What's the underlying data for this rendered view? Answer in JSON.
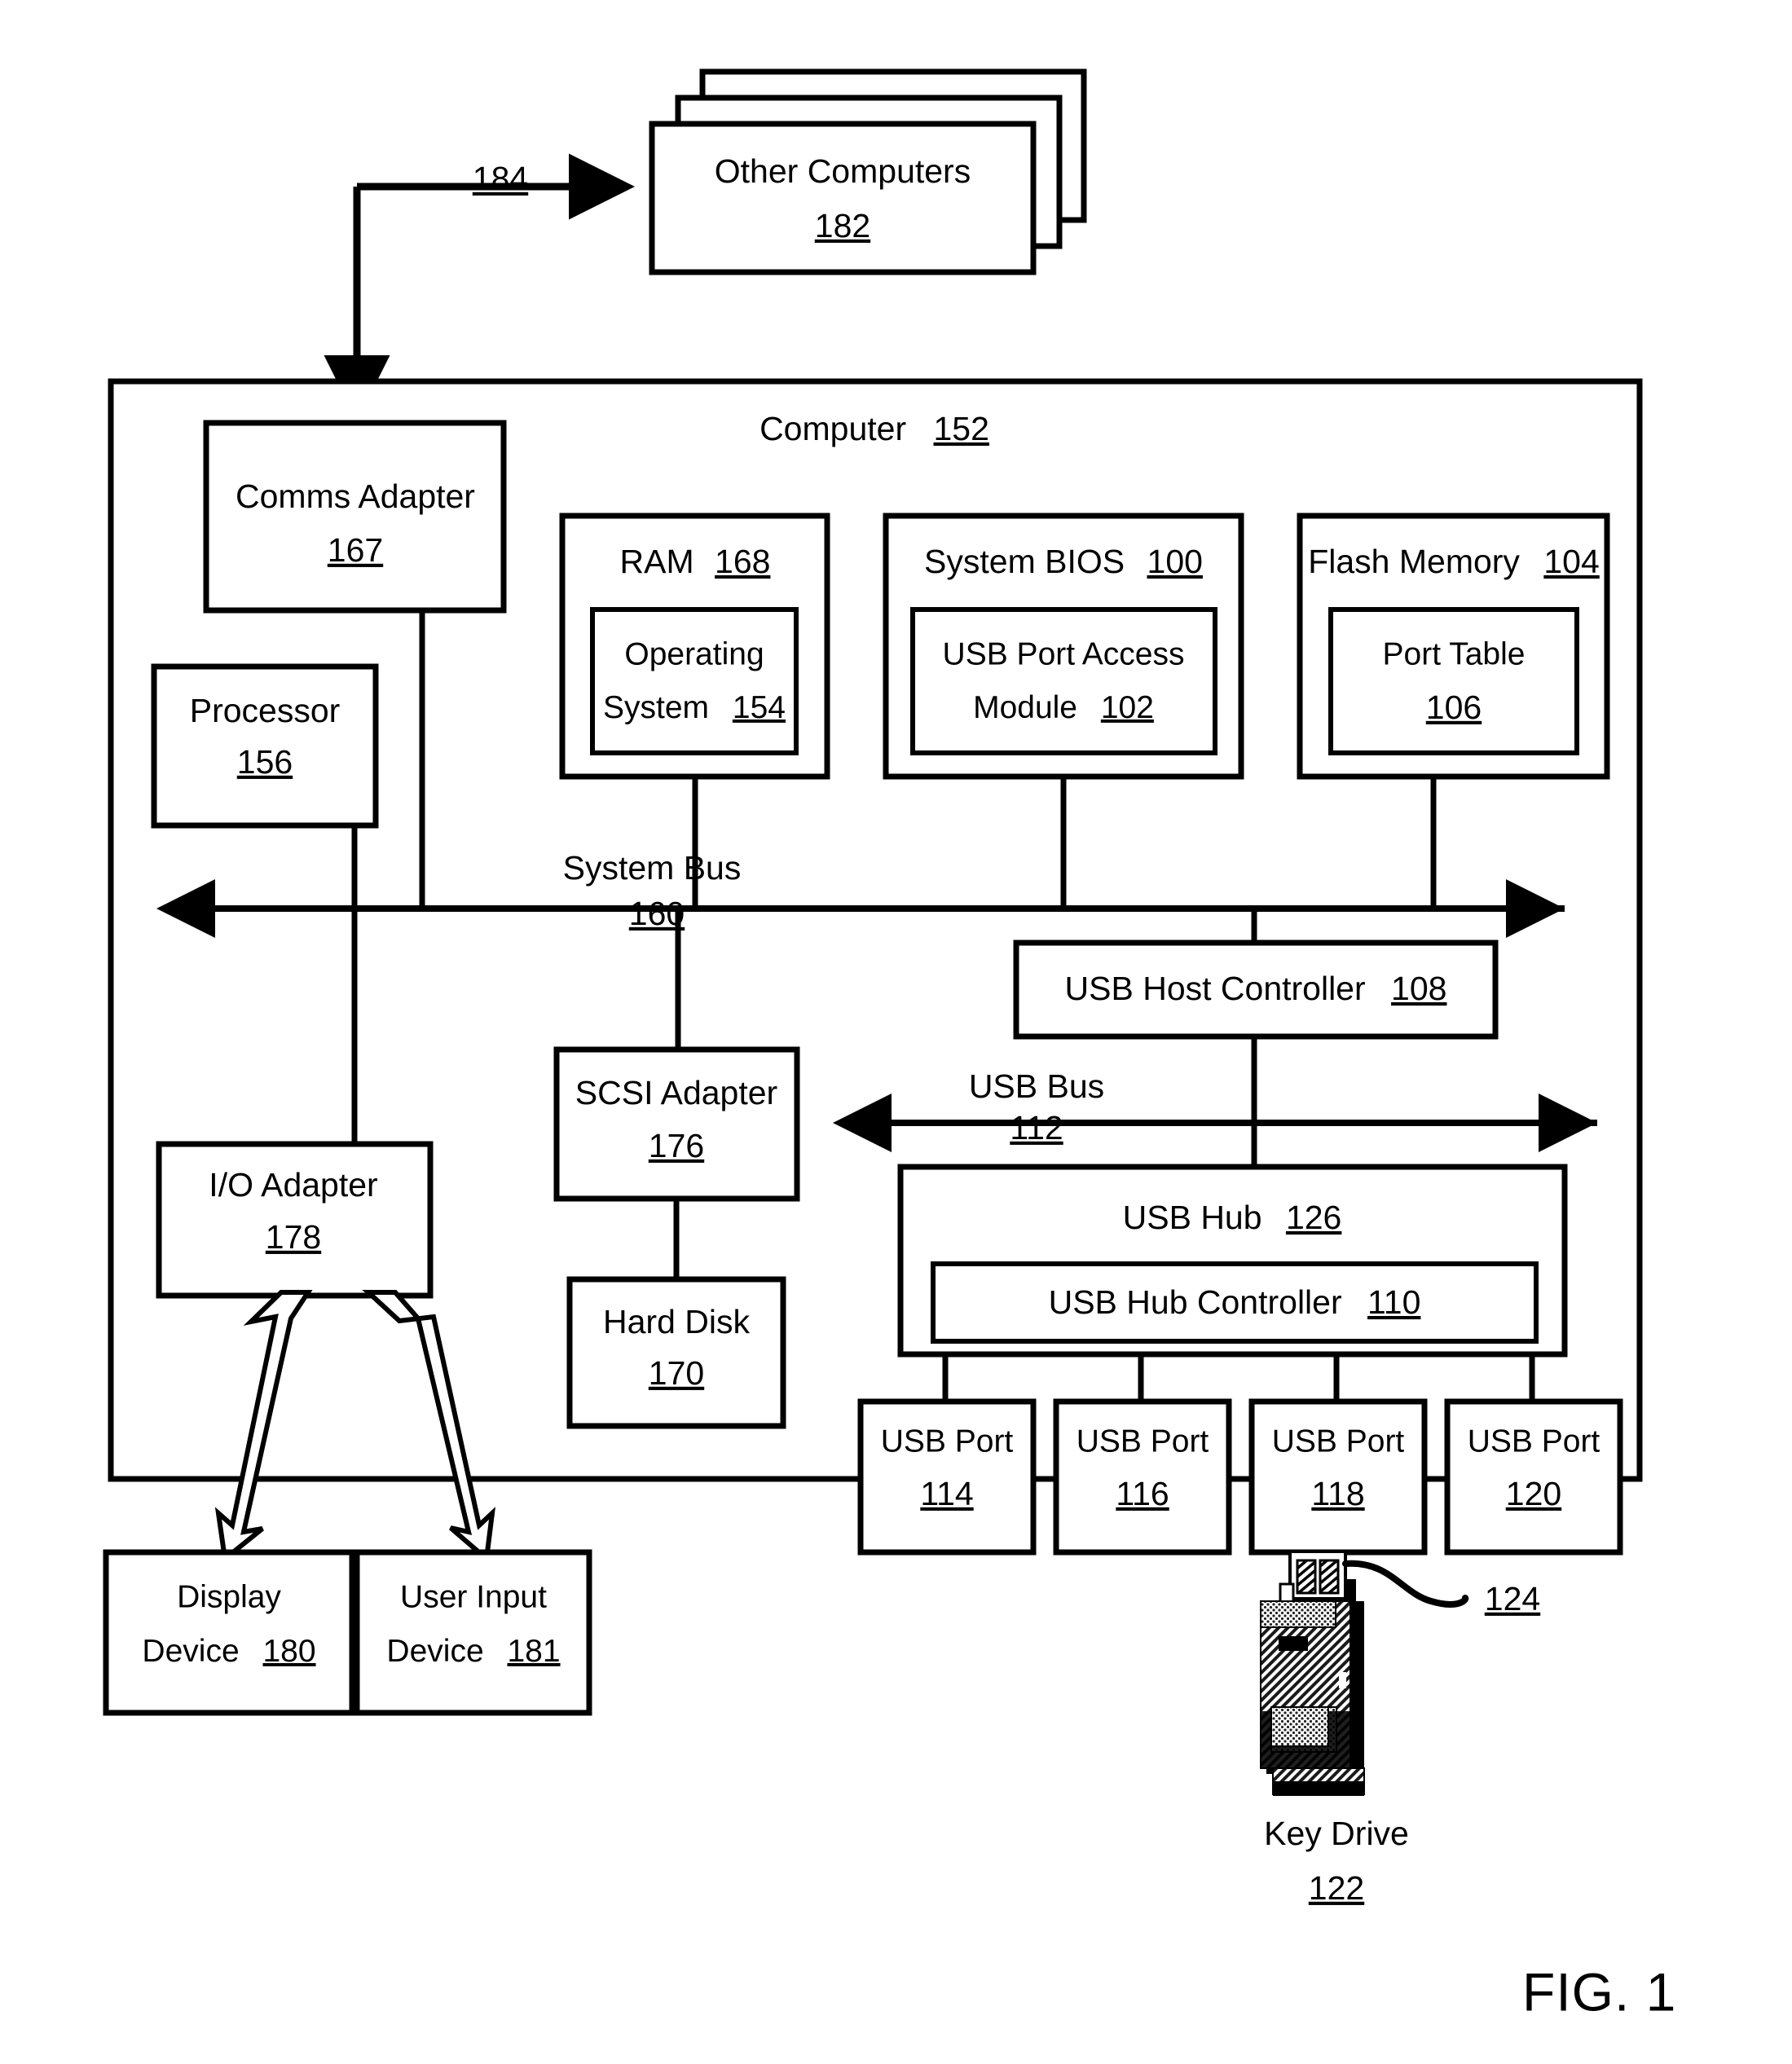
{
  "figure": {
    "caption": "FIG. 1",
    "title_block_label": "Computer",
    "title_block_ref": "152"
  },
  "external": {
    "other_computers": {
      "label": "Other Computers",
      "ref": "182"
    },
    "network_link_ref": "184"
  },
  "computer": {
    "label": "Computer",
    "ref": "152",
    "comms_adapter": {
      "label": "Comms Adapter",
      "ref": "167"
    },
    "processor": {
      "label": "Processor",
      "ref": "156"
    },
    "ram": {
      "label": "RAM",
      "ref": "168",
      "inner": {
        "line1": "Operating",
        "line2": "System",
        "ref": "154"
      }
    },
    "system_bios": {
      "label": "System BIOS",
      "ref": "100",
      "inner": {
        "line1": "USB Port Access",
        "line2": "Module",
        "ref": "102"
      }
    },
    "flash_memory": {
      "label": "Flash Memory",
      "ref": "104",
      "inner": {
        "line1": "Port Table",
        "ref": "106"
      }
    },
    "system_bus": {
      "label": "System Bus",
      "ref": "160"
    },
    "usb_host_controller": {
      "label": "USB Host Controller",
      "ref": "108"
    },
    "usb_bus": {
      "label": "USB Bus",
      "ref": "112"
    },
    "usb_hub": {
      "label": "USB Hub",
      "ref": "126",
      "controller": {
        "label": "USB Hub Controller",
        "ref": "110"
      }
    },
    "usb_ports": [
      {
        "label": "USB Port",
        "ref": "114"
      },
      {
        "label": "USB Port",
        "ref": "116"
      },
      {
        "label": "USB Port",
        "ref": "118"
      },
      {
        "label": "USB Port",
        "ref": "120"
      }
    ],
    "io_adapter": {
      "label": "I/O Adapter",
      "ref": "178"
    },
    "scsi_adapter": {
      "label": "SCSI Adapter",
      "ref": "176"
    },
    "hard_disk": {
      "label": "Hard Disk",
      "ref": "170"
    }
  },
  "peripherals": {
    "display_device": {
      "line1": "Display",
      "line2": "Device",
      "ref": "180"
    },
    "user_input_device": {
      "line1": "User Input",
      "line2": "Device",
      "ref": "181"
    },
    "key_drive": {
      "label": "Key Drive",
      "ref": "122",
      "connector_ref": "124"
    }
  },
  "colors": {
    "ink": "#000000",
    "paper": "#ffffff"
  }
}
